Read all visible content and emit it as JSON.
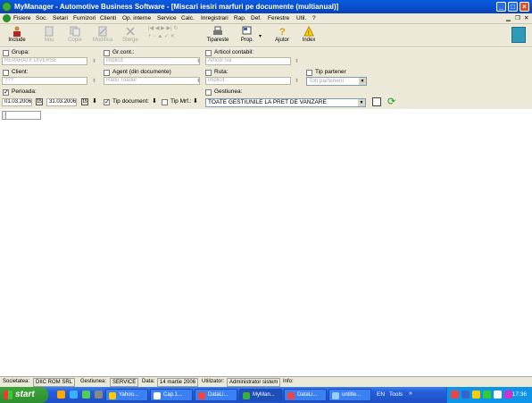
{
  "window": {
    "title": "MyManager - Automotive Business Software - [Miscari iesiri marfuri pe documente (multianual)]",
    "min": "_",
    "max": "□",
    "close": "×"
  },
  "menu": [
    "Fisiere",
    "Soc.",
    "Setari",
    "Furnizori",
    "Clienti",
    "Op. interne",
    "Service",
    "Calc.",
    "Inregistrari",
    "Rap.",
    "Def.",
    "Ferestre",
    "Util.",
    "?"
  ],
  "toolbar": {
    "include": "Include",
    "nou": "Nou",
    "copie": "Copie",
    "modifica": "Modifica",
    "sterge": "Sterge",
    "tipareste": "Tipareste",
    "prop": "Prop.",
    "ajutor": "Ajutor",
    "index": "Index"
  },
  "filters": {
    "grupa": {
      "label": "Grupa:",
      "value": "REPARATII DIVERSE"
    },
    "grcont": {
      "label": "Gr.cont.:",
      "value": "implicit"
    },
    "articol": {
      "label": "Articol contabil:",
      "value": "Articol nul"
    },
    "client": {
      "label": "Client:",
      "value": "???"
    },
    "agent": {
      "label": "Agent (din documente)",
      "value": "Radu Toader"
    },
    "ruta": {
      "label": "Ruta:",
      "value": "implicit"
    },
    "tippartener": {
      "label": "Tip partener",
      "value": "Toti partenerii"
    },
    "perioada": {
      "label": "Perioada:",
      "from": "01.03.2006",
      "to": "31.03.2006"
    },
    "tipdoc": {
      "label": "Tip document:"
    },
    "tipmrf": {
      "label": "Tip Mrf.:"
    },
    "gestiunea": {
      "label": "Gestiunea:",
      "value": "TOATE GESTIUNILE LA PRET DE VANZARE"
    }
  },
  "status": {
    "soc_label": "Societatea:",
    "soc": "DIIC ROM SRL",
    "gest_label": "Gestiunea:",
    "gest": "SERVICE",
    "data_label": "Data:",
    "data": "14 martie 2006",
    "util_label": "Utilizator:",
    "util": "Administrator sistem",
    "info_label": "Info:"
  },
  "taskbar": {
    "start": "start",
    "tasks": [
      "Yahoo...",
      "Cap.1...",
      "DataLi...",
      "MyMan...",
      "DataLi...",
      "untitle...",
      "EN"
    ],
    "tools": "Tools",
    "clock": "17:36"
  }
}
